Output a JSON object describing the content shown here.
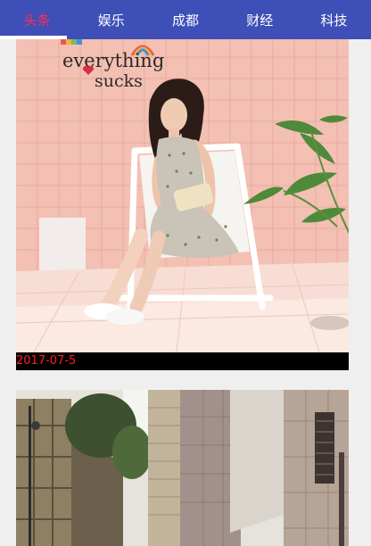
{
  "tabs": [
    {
      "label": "头条",
      "active": true
    },
    {
      "label": "娱乐",
      "active": false
    },
    {
      "label": "成都",
      "active": false
    },
    {
      "label": "财经",
      "active": false
    },
    {
      "label": "科技",
      "active": false
    }
  ],
  "colors": {
    "tab_bar": "#3e4fb8",
    "tab_active_text": "#ff2d55",
    "tab_text": "#ffffff",
    "date_text": "#ff1f1f",
    "date_background": "#000000"
  },
  "feed": {
    "items": [
      {
        "date": "2017-07-5",
        "wall_text_line1": "everything",
        "wall_text_line2": "sucks"
      },
      {
        "date": ""
      }
    ]
  }
}
